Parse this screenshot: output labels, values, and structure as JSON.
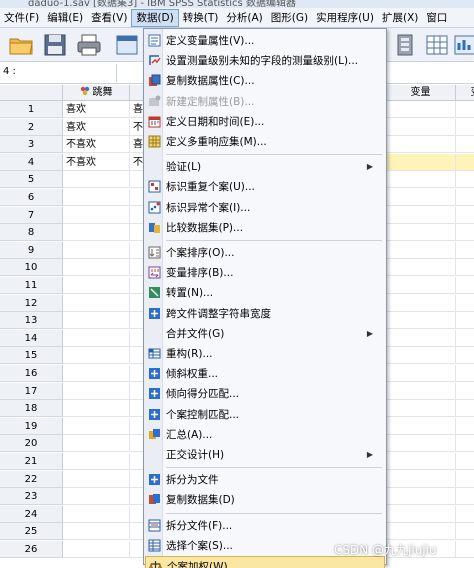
{
  "window": {
    "title": "daduo-1.sav [数据集3] - IBM SPSS Statistics 数据编辑器"
  },
  "menubar": {
    "items": [
      {
        "label": "文件(F)"
      },
      {
        "label": "编辑(E)"
      },
      {
        "label": "查看(V)"
      },
      {
        "label": "数据(D)"
      },
      {
        "label": "转换(T)"
      },
      {
        "label": "分析(A)"
      },
      {
        "label": "图形(G)"
      },
      {
        "label": "实用程序(U)"
      },
      {
        "label": "扩展(X)"
      },
      {
        "label": "窗口"
      }
    ],
    "active": "数据(D)"
  },
  "refbar": {
    "cell_ref": "4 :"
  },
  "grid": {
    "columns": [
      {
        "label": "跳舞",
        "icon": "nominal-variable-icon"
      },
      {
        "label": ""
      },
      {
        "label": "变量"
      },
      {
        "label": "变"
      }
    ],
    "rows": [
      {
        "num": "1",
        "c1": "喜欢",
        "c2": "喜"
      },
      {
        "num": "2",
        "c1": "喜欢",
        "c2": "不"
      },
      {
        "num": "3",
        "c1": "不喜欢",
        "c2": "喜"
      },
      {
        "num": "4",
        "c1": "不喜欢",
        "c2": "不"
      },
      {
        "num": "5"
      },
      {
        "num": "6"
      },
      {
        "num": "7"
      },
      {
        "num": "8"
      },
      {
        "num": "9"
      },
      {
        "num": "10"
      },
      {
        "num": "11"
      },
      {
        "num": "12"
      },
      {
        "num": "13"
      },
      {
        "num": "14"
      },
      {
        "num": "15"
      },
      {
        "num": "16"
      },
      {
        "num": "17"
      },
      {
        "num": "18"
      },
      {
        "num": "19"
      },
      {
        "num": "20"
      },
      {
        "num": "21"
      },
      {
        "num": "22"
      },
      {
        "num": "23"
      },
      {
        "num": "24"
      },
      {
        "num": "25"
      },
      {
        "num": "26"
      }
    ]
  },
  "data_menu": {
    "items": [
      {
        "label": "定义变量属性(V)...",
        "icon": "variable-properties-icon"
      },
      {
        "label": "设置测量级别未知的字段的测量级别(L)...",
        "icon": "measure-level-icon"
      },
      {
        "label": "复制数据属性(C)...",
        "icon": "copy-properties-icon"
      },
      {
        "label": "新建定制属性(B)...",
        "icon": "custom-attribute-icon",
        "disabled": true
      },
      {
        "label": "定义日期和时间(E)...",
        "icon": "calendar-icon"
      },
      {
        "label": "定义多重响应集(M)...",
        "icon": "multiple-response-icon"
      },
      {
        "sep": true
      },
      {
        "label": "验证(L)",
        "submenu": true
      },
      {
        "label": "标识重复个案(U)...",
        "icon": "duplicate-cases-icon"
      },
      {
        "label": "标识异常个案(I)...",
        "icon": "unusual-cases-icon"
      },
      {
        "label": "比较数据集(P)...",
        "icon": "compare-datasets-icon"
      },
      {
        "sep": true
      },
      {
        "label": "个案排序(O)...",
        "icon": "sort-cases-icon"
      },
      {
        "label": "变量排序(B)...",
        "icon": "sort-variables-icon"
      },
      {
        "label": "转置(N)...",
        "icon": "transpose-icon"
      },
      {
        "label": "跨文件调整字符串宽度",
        "icon": "string-width-icon"
      },
      {
        "label": "合并文件(G)",
        "submenu": true
      },
      {
        "label": "重构(R)...",
        "icon": "restructure-icon"
      },
      {
        "label": "倾斜权重...",
        "icon": "rake-weights-icon"
      },
      {
        "label": "倾向得分匹配...",
        "icon": "propensity-match-icon"
      },
      {
        "label": "个案控制匹配...",
        "icon": "case-control-icon"
      },
      {
        "label": "汇总(A)...",
        "icon": "aggregate-icon"
      },
      {
        "label": "正交设计(H)",
        "submenu": true
      },
      {
        "sep": true
      },
      {
        "label": "拆分为文件",
        "icon": "split-to-files-icon"
      },
      {
        "label": "复制数据集(D)",
        "icon": "copy-dataset-icon"
      },
      {
        "sep": true
      },
      {
        "label": "拆分文件(F)...",
        "icon": "split-file-icon"
      },
      {
        "label": "选择个案(S)...",
        "icon": "select-cases-icon"
      },
      {
        "label": "个案加权(W)...",
        "icon": "weight-cases-icon",
        "selected": true
      }
    ]
  },
  "watermark": "CSDN @九九jiujiu",
  "colors": {
    "menu_highlight": "#fbe7a4",
    "cell_highlight": "#fff3b8",
    "menubar_active": "#cfe0f5"
  }
}
